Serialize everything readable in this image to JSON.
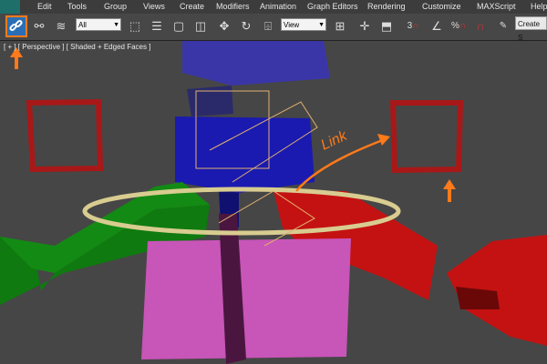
{
  "menubar": {
    "items": [
      "Edit",
      "Tools",
      "Group",
      "Views",
      "Create",
      "Modifiers",
      "Animation",
      "Graph Editors",
      "Rendering",
      "Customize",
      "MAXScript",
      "Help"
    ]
  },
  "toolbar": {
    "selection_filter": "All",
    "ref_coord": "View",
    "named_selection_placeholder": "Create S",
    "snap_label": "3",
    "percent_snap": "%",
    "icons": [
      "link-icon",
      "unlink-icon",
      "bind-space-warp-icon",
      "select-object-icon",
      "select-by-name-icon",
      "rect-region-icon",
      "window-crossing-icon",
      "move-icon",
      "rotate-icon",
      "use-pivot-icon",
      "select-manipulate-icon",
      "keyboard-shortcut-icon",
      "snap-toggle-icon",
      "angle-snap-icon",
      "percent-snap-icon",
      "spinner-snap-icon",
      "edit-named-selection-icon"
    ]
  },
  "viewport": {
    "label": "[ + ] [ Perspective ] [ Shaded + Edged Faces ]",
    "annotation": "Link",
    "colors": {
      "highlight": "#ff7a1a",
      "blue": "#1a1ab0",
      "red": "#cc1111",
      "green": "#0f7a0f",
      "pink": "#c855b8",
      "ring": "#d8cc90"
    }
  }
}
